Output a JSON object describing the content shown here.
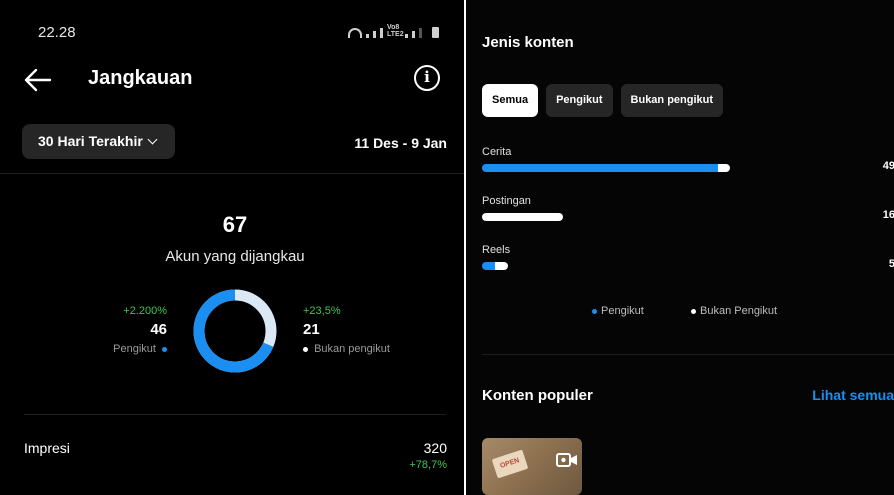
{
  "status": {
    "time": "22.28",
    "icons": [
      "wifi-icon",
      "signal-icon",
      "volte-icon",
      "signal-icon",
      "battery-icon"
    ],
    "volte_text": "Vo8 LTE2"
  },
  "header": {
    "title": "Jangkauan",
    "back_icon": "arrow-left-icon",
    "info_icon": "info-icon",
    "info_glyph": "i"
  },
  "filter": {
    "range_label": "30 Hari Terakhir",
    "date_range": "11 Des - 9 Jan"
  },
  "reach": {
    "total": "67",
    "total_label": "Akun yang dijangkau",
    "followers": {
      "change": "+2.200%",
      "count": "46",
      "label": "Pengikut",
      "share": 0.687
    },
    "non_followers": {
      "change": "+23,5%",
      "count": "21",
      "label": "Bukan pengikut",
      "share": 0.313
    }
  },
  "impressions": {
    "label": "Impresi",
    "value": "320",
    "change": "+78,7%"
  },
  "content_types": {
    "title": "Jenis konten",
    "tabs": [
      {
        "label": "Semua",
        "active": true
      },
      {
        "label": "Pengikut",
        "active": false
      },
      {
        "label": "Bukan pengikut",
        "active": false
      }
    ],
    "rows": [
      {
        "label": "Cerita",
        "value": "49",
        "value_num": 49,
        "followers_share": 0.95
      },
      {
        "label": "Postingan",
        "value": "16",
        "value_num": 16,
        "followers_share": 0.0
      },
      {
        "label": "Reels",
        "value": "5",
        "value_num": 5,
        "followers_share": 0.5
      }
    ],
    "legend": {
      "followers": "Pengikut",
      "non_followers": "Bukan Pengikut"
    }
  },
  "popular": {
    "title": "Konten populer",
    "see_all": "Lihat semua",
    "thumb_sticker": "OPEN"
  },
  "colors": {
    "background": "#000000",
    "accent_blue": "#1b8ef2",
    "positive_green": "#3ec653",
    "chip_bg": "#262626",
    "non_follower": "#ffffff"
  }
}
